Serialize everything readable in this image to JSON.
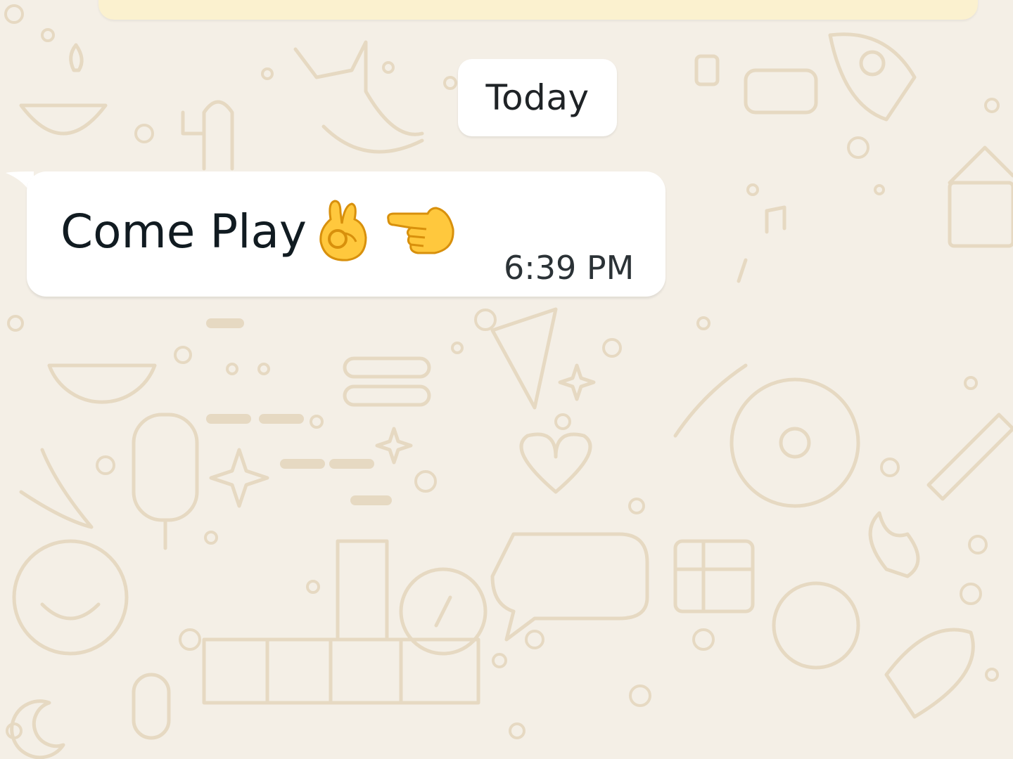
{
  "chat": {
    "date_separator": "Today",
    "messages": [
      {
        "direction": "incoming",
        "text": "Come Play",
        "emojis": [
          "ok-hand-emoji",
          "pointing-right-emoji"
        ],
        "time": "6:39 PM"
      }
    ]
  },
  "colors": {
    "wallpaper": "#f4efe6",
    "doodle": "#e8dcc6",
    "bubble": "#ffffff",
    "banner": "#fbf1cf",
    "emoji_yellow": "#ffc83d",
    "emoji_outline": "#e09a12"
  }
}
